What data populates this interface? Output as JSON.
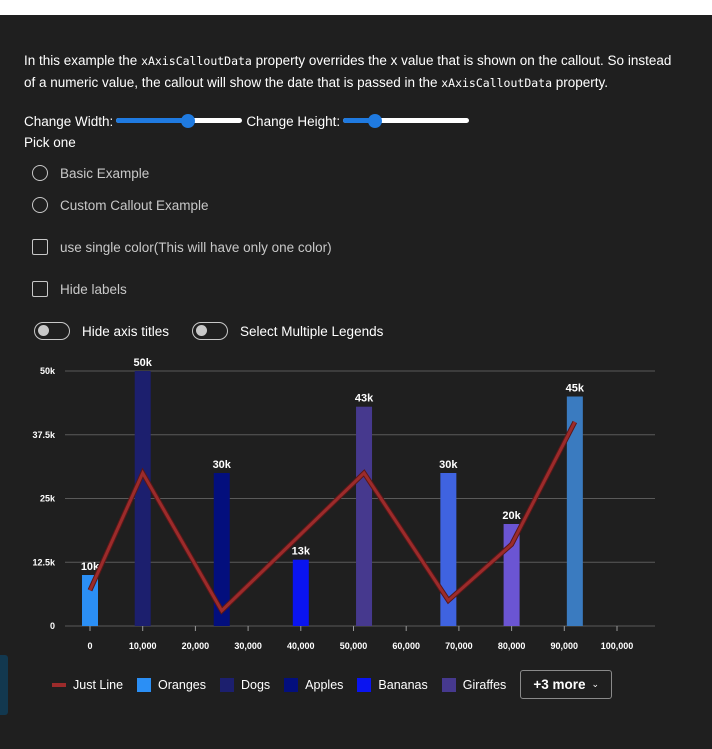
{
  "description": {
    "p1": "In this example the ",
    "code1": "xAxisCalloutData",
    "p2": " property overrides the x value that is shown on the callout. So instead of a numeric value, the callout will show the date that is passed in the ",
    "code2": "xAxisCalloutData",
    "p3": " property."
  },
  "controls": {
    "change_width_label": "Change Width:",
    "change_height_label": "Change Height:",
    "width_slider_value": 0.58,
    "height_slider_value": 0.22,
    "pick_label": "Pick one",
    "radio_options": [
      "Basic Example",
      "Custom Callout Example"
    ],
    "single_color_label": "use single color(This will have only one color)",
    "hide_labels_label": "Hide labels",
    "hide_axis_titles_label": "Hide axis titles",
    "select_multiple_legends_label": "Select Multiple Legends"
  },
  "colors": {
    "accent": "#1f7ae0",
    "line": "#9c2b2b",
    "gridline": "#5a5a5a"
  },
  "chart_data": {
    "type": "bar",
    "xlim": [
      0,
      100000
    ],
    "ylim": [
      0,
      50000
    ],
    "x_ticks": [
      "0",
      "10,000",
      "20,000",
      "30,000",
      "40,000",
      "50,000",
      "60,000",
      "70,000",
      "80,000",
      "90,000",
      "100,000"
    ],
    "y_ticks": [
      "0",
      "12.5k",
      "25k",
      "37.5k",
      "50k"
    ],
    "y_tick_values": [
      0,
      12500,
      25000,
      37500,
      50000
    ],
    "grid": true,
    "bars": [
      {
        "x": 0,
        "y": 10000,
        "label": "10k",
        "legend": "Oranges",
        "color": "#2b8ff5"
      },
      {
        "x": 10000,
        "y": 50000,
        "label": "50k",
        "legend": "Dogs",
        "color": "#1c1f6e"
      },
      {
        "x": 25000,
        "y": 30000,
        "label": "30k",
        "legend": "Apples",
        "color": "#030f7d"
      },
      {
        "x": 40000,
        "y": 13000,
        "label": "13k",
        "legend": "Bananas",
        "color": "#0a14f0"
      },
      {
        "x": 52000,
        "y": 43000,
        "label": "43k",
        "legend": "Giraffes",
        "color": "#46398e"
      },
      {
        "x": 68000,
        "y": 30000,
        "label": "30k",
        "legend": "",
        "color": "#3f63e0"
      },
      {
        "x": 80000,
        "y": 20000,
        "label": "20k",
        "legend": "",
        "color": "#6b55d3"
      },
      {
        "x": 92000,
        "y": 45000,
        "label": "45k",
        "legend": "",
        "color": "#3a7bc0"
      }
    ],
    "line": {
      "name": "Just Line",
      "points": [
        [
          0,
          7000
        ],
        [
          10000,
          30000
        ],
        [
          25000,
          3000
        ],
        [
          52000,
          30000
        ],
        [
          68000,
          5000
        ],
        [
          80000,
          16000
        ],
        [
          92000,
          40000
        ]
      ]
    }
  },
  "legend": {
    "items": [
      {
        "label": "Just Line",
        "color": "#9c2b2b",
        "kind": "line"
      },
      {
        "label": "Oranges",
        "color": "#2b8ff5",
        "kind": "box"
      },
      {
        "label": "Dogs",
        "color": "#1c1f6e",
        "kind": "box"
      },
      {
        "label": "Apples",
        "color": "#030f7d",
        "kind": "box"
      },
      {
        "label": "Bananas",
        "color": "#0a14f0",
        "kind": "box"
      },
      {
        "label": "Giraffes",
        "color": "#46398e",
        "kind": "box"
      }
    ],
    "more_label": "+3 more"
  }
}
